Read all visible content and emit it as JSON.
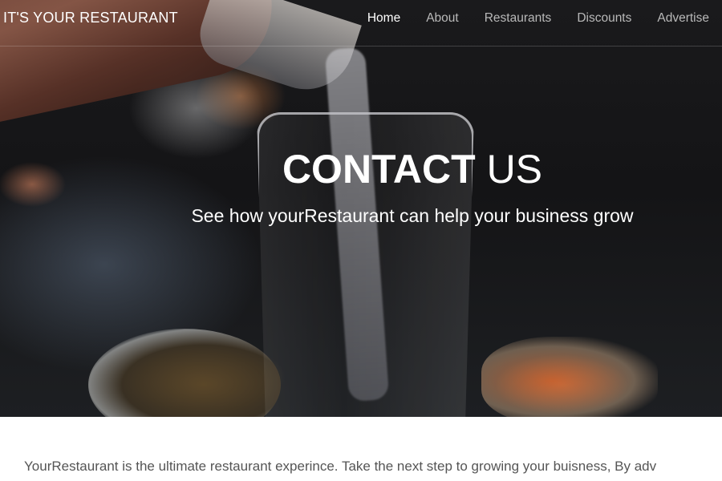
{
  "brand": "IT'S YOUR RESTAURANT",
  "nav": {
    "items": [
      {
        "label": "Home",
        "active": true
      },
      {
        "label": "About",
        "active": false
      },
      {
        "label": "Restaurants",
        "active": false
      },
      {
        "label": "Discounts",
        "active": false
      },
      {
        "label": "Advertise",
        "active": false
      }
    ]
  },
  "hero": {
    "title_strong": "CONTACT",
    "title_light": "US",
    "subtitle": "See how yourRestaurant can help your business grow"
  },
  "intro": {
    "text": "YourRestaurant is the ultimate restaurant experince. Take the next step to growing your buisness, By adv"
  }
}
